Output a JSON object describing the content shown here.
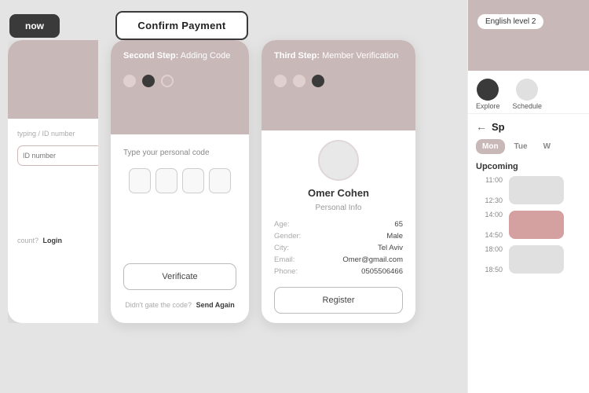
{
  "panels": {
    "panel1": {
      "top_bg": "#c9b8b8",
      "label_id": "typing / ID number",
      "input_placeholder": "ID number",
      "btn_now": "now",
      "footer": "count?",
      "login_label": "Login"
    },
    "panel2": {
      "confirm_btn": "Confirm Payment",
      "step_label_bold": "Second Step:",
      "step_label_rest": " Adding Code",
      "body_label": "Type your personal code",
      "btn_verificate": "Verificate",
      "resend_prefix": "Didn't gate the code?",
      "resend_action": "Send Again",
      "dots": [
        "inactive",
        "active",
        "outline"
      ]
    },
    "panel3": {
      "step_label_bold": "Third Step:",
      "step_label_rest": " Member Verification",
      "user_name": "Omer Cohen",
      "section_title": "Personal Info",
      "age_label": "Age:",
      "age_value": "65",
      "gender_label": "Gender:",
      "gender_value": "Male",
      "city_label": "City:",
      "city_value": "Tel Aviv",
      "email_label": "Email:",
      "email_value": "Omer@gmail.com",
      "phone_label": "Phone:",
      "phone_value": "0505506466",
      "btn_register": "Register",
      "dots": [
        "inactive",
        "inactive",
        "active"
      ]
    },
    "panel4": {
      "lang_badge": "English level 2",
      "back_icon": "←",
      "sp_title": "Sp",
      "day_tabs": [
        "Mon",
        "Tue",
        "W"
      ],
      "upcoming_label": "Upcoming",
      "slots": [
        {
          "start": "11:00",
          "end": "12:30",
          "color": "grey"
        },
        {
          "start": "14:00",
          "end": "14:50",
          "color": "pink"
        },
        {
          "start": "18:00",
          "end": "18:50",
          "color": "grey"
        }
      ]
    }
  }
}
